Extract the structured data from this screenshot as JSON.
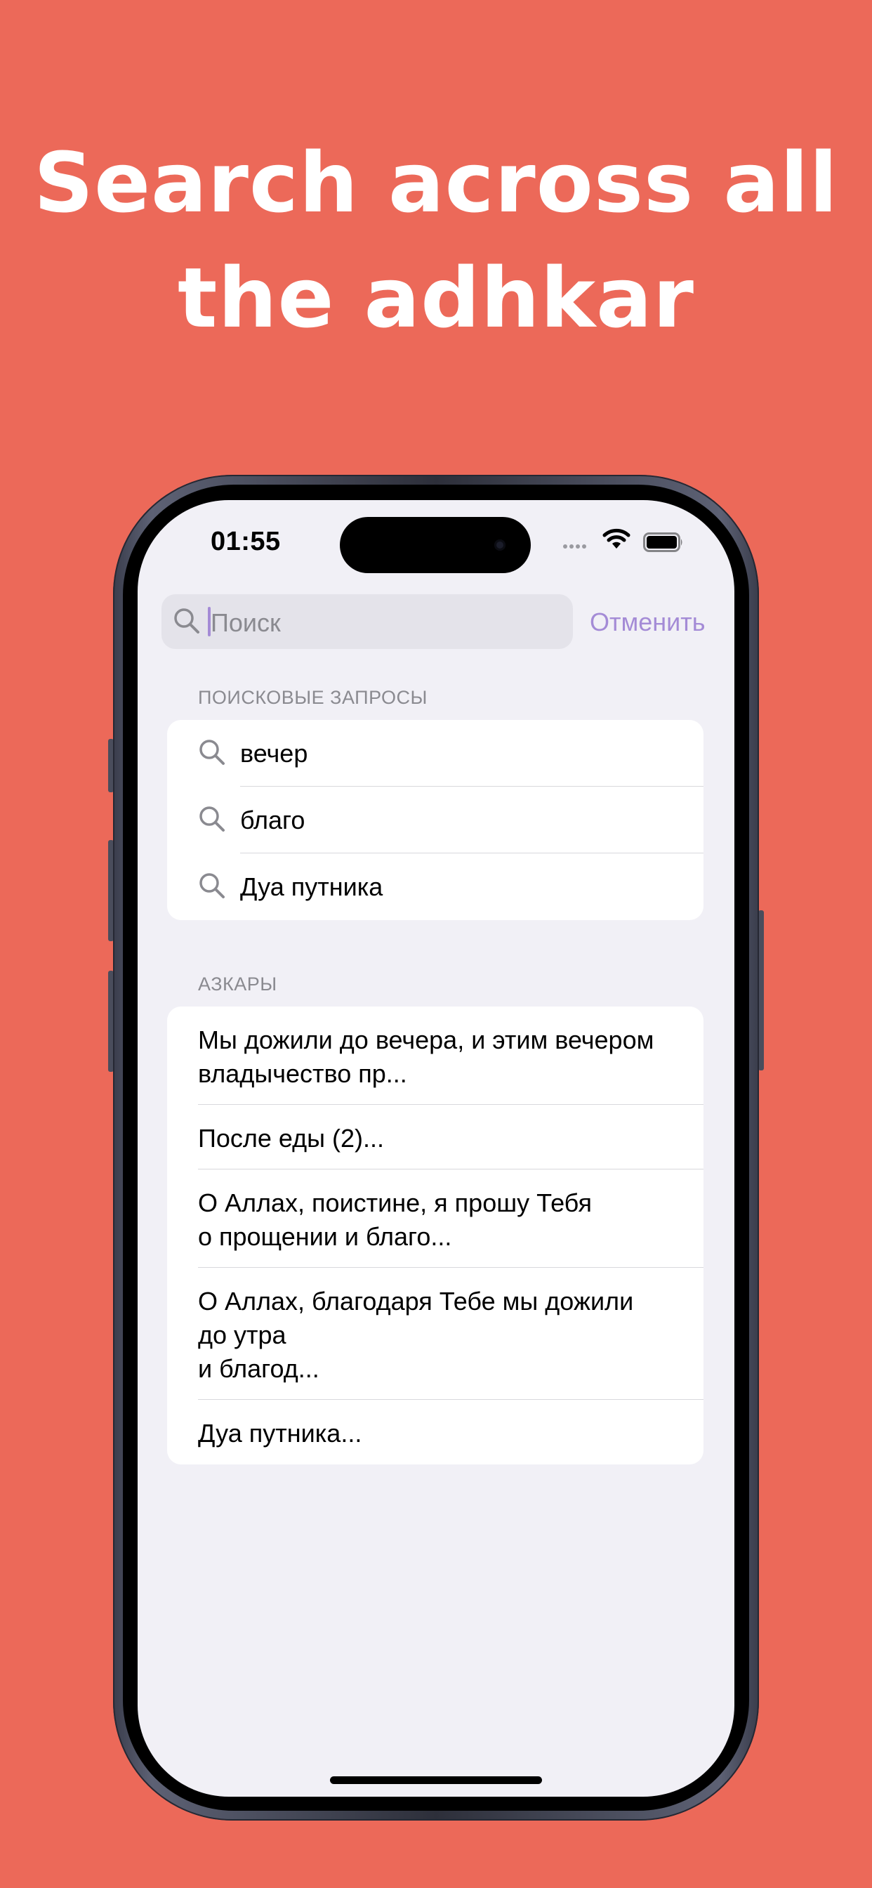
{
  "headline": {
    "line1": "Search across all",
    "line2": "the adhkar"
  },
  "colors": {
    "background": "#EC6959",
    "accent": "#A48BD6",
    "screen_background": "#F1F0F6"
  },
  "status_bar": {
    "time": "01:55",
    "icons": [
      "cellular-dots-icon",
      "wifi-icon",
      "battery-icon"
    ]
  },
  "search": {
    "placeholder": "Поиск",
    "cancel_label": "Отменить",
    "icon": "search-icon"
  },
  "recent_searches": {
    "header": "ПОИСКОВЫЕ ЗАПРОСЫ",
    "items": [
      {
        "label": "вечер",
        "icon": "search-icon"
      },
      {
        "label": "благо",
        "icon": "search-icon"
      },
      {
        "label": "Дуа путника",
        "icon": "search-icon"
      }
    ]
  },
  "adhkar": {
    "header": "АЗКАРЫ",
    "items": [
      {
        "text": "Мы дожили до вечера, и этим вечером\nвладычество пр..."
      },
      {
        "text": "После еды (2)..."
      },
      {
        "text": "О Аллах, поистине, я прошу Тебя\nо прощении и благо..."
      },
      {
        "text": "О Аллах, благодаря Тебе мы дожили\nдо утра\nи благод..."
      },
      {
        "text": "Дуа путника..."
      }
    ]
  }
}
